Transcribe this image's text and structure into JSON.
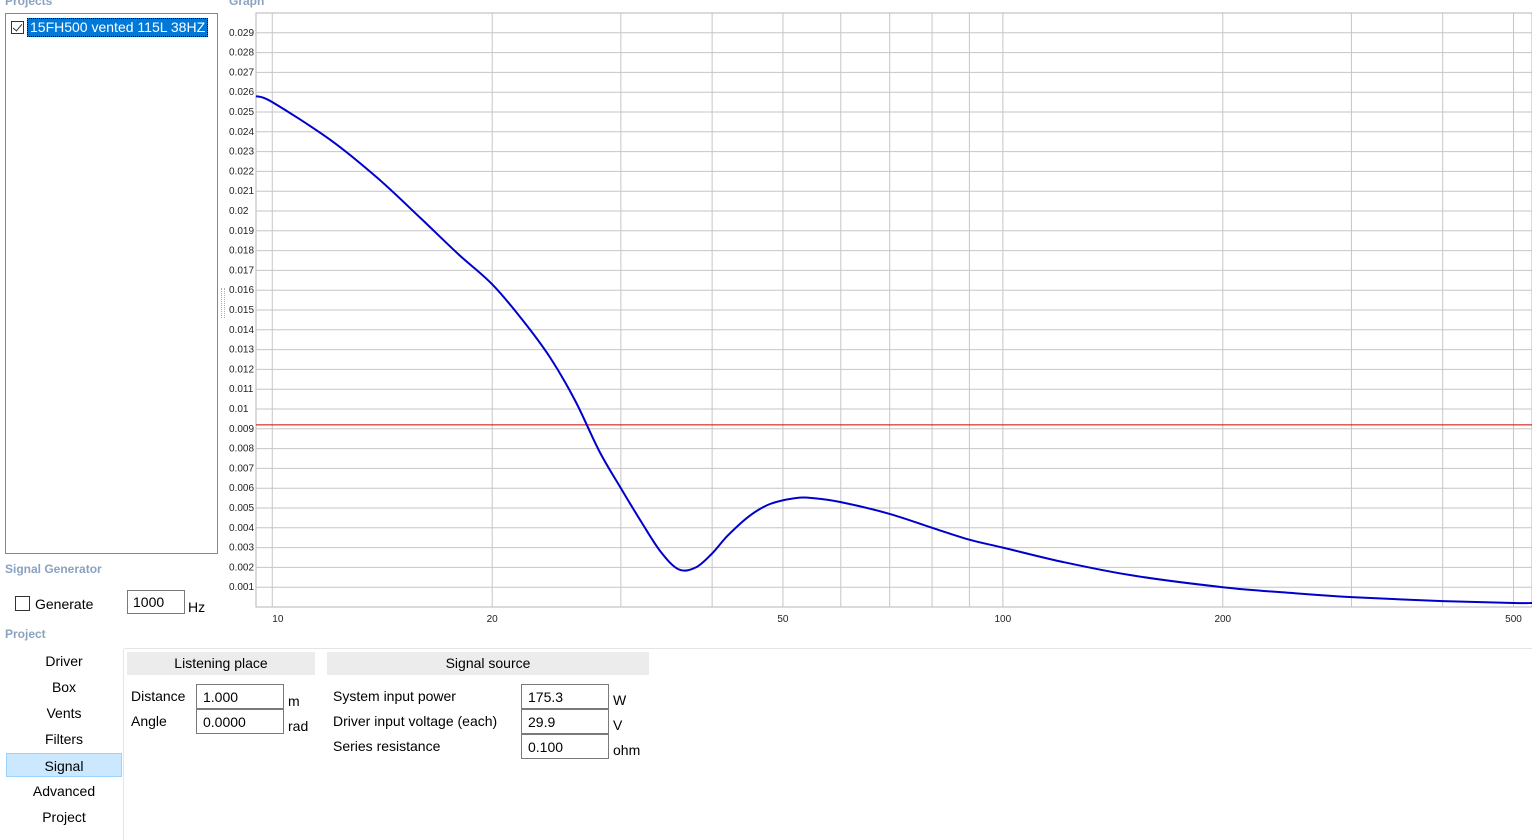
{
  "sections": {
    "projects": "Projects",
    "graph": "Graph",
    "signal_generator": "Signal Generator",
    "project": "Project"
  },
  "projects": [
    {
      "name": "15FH500 vented 115L 38HZ",
      "checked": true
    }
  ],
  "signal_generator": {
    "generate_label": "Generate",
    "generate_checked": false,
    "frequency": "1000",
    "unit": "Hz"
  },
  "nav": {
    "items": [
      "Driver",
      "Box",
      "Vents",
      "Filters",
      "Signal",
      "Advanced",
      "Project"
    ],
    "active": "Signal"
  },
  "listening_place": {
    "header": "Listening place",
    "distance_label": "Distance",
    "distance_value": "1.000",
    "distance_unit": "m",
    "angle_label": "Angle",
    "angle_value": "0.0000",
    "angle_unit": "rad"
  },
  "signal_source": {
    "header": "Signal source",
    "power_label": "System input power",
    "power_value": "175.3",
    "power_unit": "W",
    "voltage_label": "Driver input voltage (each)",
    "voltage_value": "29.9",
    "voltage_unit": "V",
    "resistance_label": "Series resistance",
    "resistance_value": "0.100",
    "resistance_unit": "ohm"
  },
  "chart_data": {
    "type": "line",
    "x_scale": "log",
    "xlim": [
      9.5,
      530
    ],
    "ylim": [
      0,
      0.03
    ],
    "x_tick_labels": [
      "10",
      "20",
      "50",
      "100",
      "200",
      "500"
    ],
    "x_ticks": [
      10,
      20,
      50,
      100,
      200,
      500
    ],
    "y_ticks": [
      "0.001",
      "0.002",
      "0.003",
      "0.004",
      "0.005",
      "0.006",
      "0.007",
      "0.008",
      "0.009",
      "0.01",
      "0.011",
      "0.012",
      "0.013",
      "0.014",
      "0.015",
      "0.016",
      "0.017",
      "0.018",
      "0.019",
      "0.02",
      "0.021",
      "0.022",
      "0.023",
      "0.024",
      "0.025",
      "0.026",
      "0.027",
      "0.028",
      "0.029"
    ],
    "grid": true,
    "series": [
      {
        "color": "#0000cc",
        "x": [
          9.5,
          10,
          12,
          14,
          16,
          18,
          20,
          22,
          24,
          26,
          28,
          30,
          32,
          34,
          36,
          38,
          40,
          42,
          45,
          48,
          52,
          55,
          60,
          70,
          80,
          90,
          100,
          120,
          150,
          200,
          250,
          300,
          400,
          500,
          530
        ],
        "y": [
          0.0258,
          0.0255,
          0.0236,
          0.0216,
          0.0196,
          0.0178,
          0.0163,
          0.0145,
          0.0126,
          0.0104,
          0.0079,
          0.006,
          0.0043,
          0.0028,
          0.0019,
          0.002,
          0.0027,
          0.0036,
          0.0046,
          0.0052,
          0.0055,
          0.0055,
          0.0053,
          0.0047,
          0.004,
          0.0034,
          0.003,
          0.0023,
          0.0016,
          0.001,
          0.0007,
          0.0005,
          0.0003,
          0.0002,
          0.0002
        ]
      }
    ],
    "reference_line": {
      "y": 0.0092,
      "color": "#cc0000"
    }
  }
}
